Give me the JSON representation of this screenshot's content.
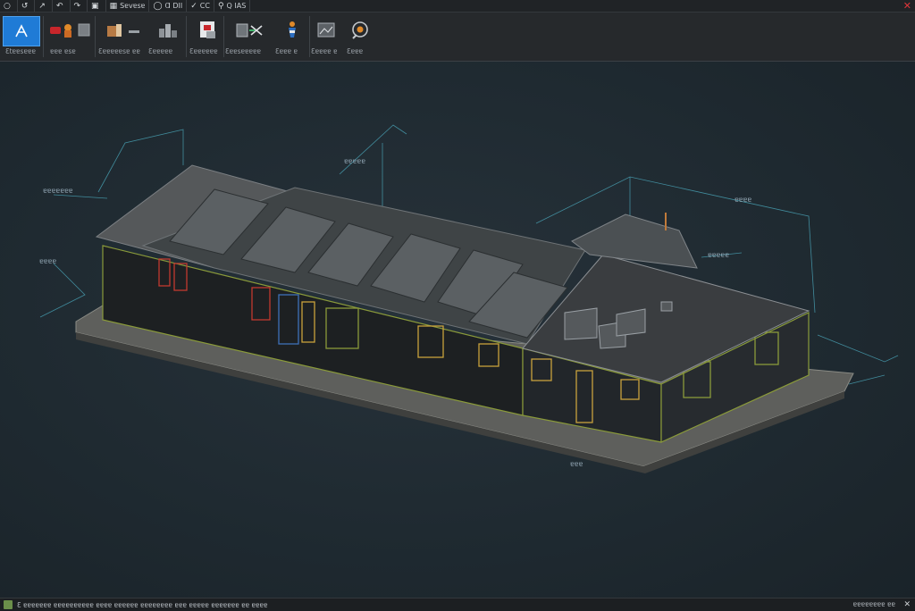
{
  "quick_access": {
    "items": [
      {
        "label": "",
        "icon": "app-menu-icon"
      },
      {
        "label": "",
        "icon": "open-icon"
      },
      {
        "label": "",
        "icon": "measure-icon"
      },
      {
        "label": "",
        "icon": "undo-icon"
      },
      {
        "label": "",
        "icon": "redo-icon"
      },
      {
        "label": "",
        "icon": "print-icon"
      },
      {
        "label": "Sɐvɐsɐ",
        "icon": "save-icon"
      },
      {
        "label": "Ɑ DII",
        "icon": "view-icon"
      },
      {
        "label": "CC",
        "icon": "sync-icon"
      },
      {
        "label": "Q IAS",
        "icon": "search-icon"
      }
    ]
  },
  "ribbon": {
    "buttons": [
      {
        "name": "modify-button",
        "label": "Ɛtɐɐsɐɐɐ",
        "icon": "modify-icon",
        "active": true
      },
      {
        "name": "element-button",
        "label": "ɐɐɐ ɐsɐ",
        "icon": "element-icon",
        "active": false
      },
      {
        "name": "architecture-button",
        "label": "Ɛɐɐɐɐɐsɐ ɐɐ",
        "icon": "architecture-icon",
        "active": false
      },
      {
        "name": "structure-button",
        "label": "Ɛɐɐɐɐɐ",
        "icon": "structure-icon",
        "active": false
      },
      {
        "name": "properties-button",
        "label": "Ɛɐɐɐɐɐɐ",
        "icon": "properties-icon",
        "active": false
      },
      {
        "name": "collaborate-button",
        "label": "Ɛɐɐsɐɐɐɐɐ",
        "icon": "collaborate-icon",
        "active": false
      },
      {
        "name": "manage-button",
        "label": "Ɛɐɐɐ ɐ",
        "icon": "manage-icon",
        "active": false
      },
      {
        "name": "view-button",
        "label": "Ɛɐɐɐɐ ɐ",
        "icon": "view-icon",
        "active": false
      },
      {
        "name": "inspect-button",
        "label": "Ɛɐɐɐ",
        "icon": "inspect-icon",
        "active": false
      }
    ]
  },
  "viewport": {
    "annotations": [
      {
        "name": "annotation-top-left",
        "text": "ɐɐɐɐɐɐɐ"
      },
      {
        "name": "annotation-left",
        "text": "ɐɐɐɐ"
      },
      {
        "name": "annotation-top",
        "text": "ɐɐɐɐɐ"
      },
      {
        "name": "annotation-right",
        "text": "ɐɐɐɐ"
      },
      {
        "name": "annotation-right-lower",
        "text": "ɐɐɐɐɐ"
      },
      {
        "name": "annotation-bottom",
        "text": "ɐɐɐ"
      }
    ]
  },
  "status_bar": {
    "left_text": "Ɛ ɐɐɐɐɐɐɐ ɐɐɐɐɐɐɐɐɐɐ ɐɐɐɐ ɐɐɐɐɐɐ ɐɐɐɐɐɐɐɐ ɐɐɐ ɐɐɐɐɐ ɐɐɐɐɐɐɐ ɐɐ ɐɐɐɐ",
    "right_text": "ɐɐɐɐɐɐɐɐ ɐɐ"
  },
  "colors": {
    "accent": "#1f7bd6",
    "background": "#1e262c",
    "ribbon": "#26292c",
    "close": "#e0363a"
  }
}
